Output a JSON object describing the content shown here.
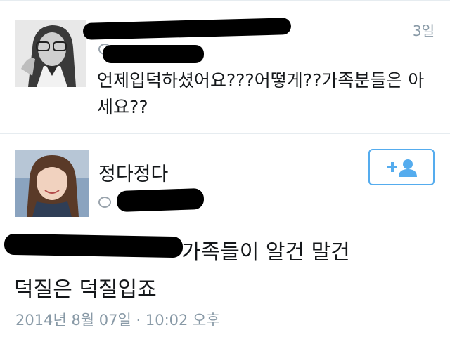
{
  "reply": {
    "time": "3일",
    "text": "언제입덕하셨어요???어떻게??가족분들은 아세요??"
  },
  "tweet": {
    "display_name": "정다정다",
    "text_line1": "가족들이 알건 말건",
    "text_line2": "덕질은 덕질입죠",
    "timestamp": "2014년 8월 07일 · 10:02 오후"
  },
  "icons": {
    "follow": "add-user-icon"
  },
  "colors": {
    "accent": "#55acee",
    "muted_text": "#8899a6",
    "divider": "#e6ecf0"
  }
}
